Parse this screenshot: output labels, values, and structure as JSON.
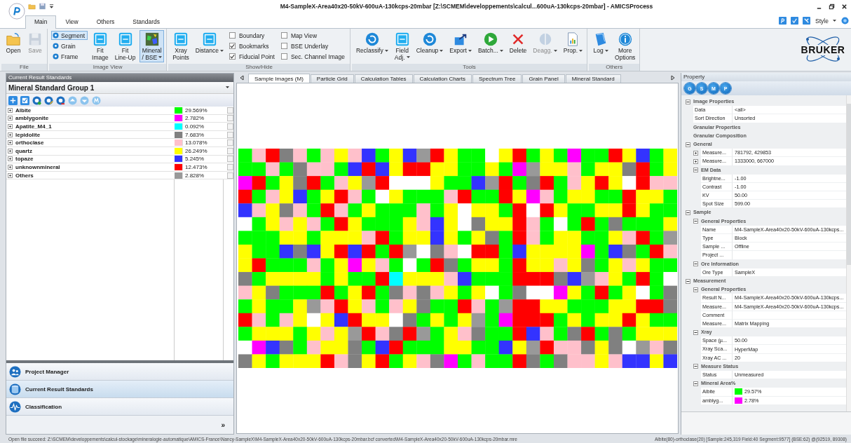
{
  "window": {
    "title": "M4-SampleX-Area40x20-50kV-600uA-130kcps-20mbar [Z:\\SCMEM\\developpements\\calcul...600uA-130kcps-20mbar] - AMICSProcess"
  },
  "ribbon_tabs": [
    {
      "label": "Main",
      "selected": true
    },
    {
      "label": "View",
      "selected": false
    },
    {
      "label": "Others",
      "selected": false
    },
    {
      "label": "Standards",
      "selected": false
    }
  ],
  "style_menu": {
    "label": "Style"
  },
  "ribbon_groups": [
    {
      "label": "File",
      "items": [
        {
          "kind": "large",
          "label": "Open",
          "disabled": false,
          "pressed": false,
          "dropdown": false
        },
        {
          "kind": "large",
          "label": "Save",
          "disabled": true,
          "pressed": false,
          "dropdown": false
        }
      ]
    },
    {
      "label": "Image View",
      "items": [
        {
          "kind": "radio",
          "label": "Segment",
          "selected": true
        },
        {
          "kind": "radio",
          "label": "Grain",
          "selected": false
        },
        {
          "kind": "radio",
          "label": "Frame",
          "selected": false
        },
        {
          "kind": "large",
          "label": "Fit\nImage",
          "disabled": false,
          "pressed": false,
          "dropdown": false
        },
        {
          "kind": "large",
          "label": "Fit\nLine-Up",
          "disabled": false,
          "pressed": false,
          "dropdown": false
        },
        {
          "kind": "large",
          "label": "Mineral\n/ BSE",
          "disabled": false,
          "pressed": true,
          "dropdown": true
        }
      ]
    },
    {
      "label": "Show/Hide",
      "items": [
        {
          "kind": "large",
          "label": "Xray\nPoints",
          "disabled": false,
          "pressed": false,
          "dropdown": false
        },
        {
          "kind": "large",
          "label": "Distance",
          "disabled": false,
          "pressed": false,
          "dropdown": true
        },
        {
          "kind": "check",
          "label": "Boundary",
          "checked": false
        },
        {
          "kind": "check",
          "label": "Bookmarks",
          "checked": true
        },
        {
          "kind": "check",
          "label": "Fiducial Point",
          "checked": true
        },
        {
          "kind": "check",
          "label": "Map View",
          "checked": false
        },
        {
          "kind": "check",
          "label": "BSE Underlay",
          "checked": false
        },
        {
          "kind": "check",
          "label": "Sec. Channel Image",
          "checked": false
        }
      ]
    },
    {
      "label": "Tools",
      "items": [
        {
          "kind": "large",
          "label": "Reclassify",
          "disabled": false,
          "pressed": false,
          "dropdown": true
        },
        {
          "kind": "large",
          "label": "Field\nAdj.",
          "disabled": false,
          "pressed": false,
          "dropdown": true
        },
        {
          "kind": "large",
          "label": "Cleanup",
          "disabled": false,
          "pressed": false,
          "dropdown": true
        },
        {
          "kind": "large",
          "label": "Export",
          "disabled": false,
          "pressed": false,
          "dropdown": true
        },
        {
          "kind": "large",
          "label": "Batch...",
          "disabled": false,
          "pressed": false,
          "dropdown": true
        },
        {
          "kind": "large",
          "label": "Delete",
          "disabled": false,
          "pressed": false,
          "dropdown": false
        },
        {
          "kind": "large",
          "label": "Deagg.",
          "disabled": true,
          "pressed": false,
          "dropdown": true
        },
        {
          "kind": "large",
          "label": "Prop.",
          "disabled": false,
          "pressed": false,
          "dropdown": true
        }
      ]
    },
    {
      "label": "Others",
      "items": [
        {
          "kind": "large",
          "label": "Log",
          "disabled": false,
          "pressed": false,
          "dropdown": true
        },
        {
          "kind": "large",
          "label": "More\nOptions",
          "disabled": false,
          "pressed": false,
          "dropdown": false
        }
      ]
    }
  ],
  "brand": {
    "logo_text": "BRUKER"
  },
  "left_panel": {
    "header": "Current Result Standards",
    "group_select": {
      "value": "Mineral Standard Group 1"
    }
  },
  "minerals": [
    {
      "name": "Albite",
      "color": "#00ff00",
      "percent": "29.569%",
      "checked": false
    },
    {
      "name": "amblygonite",
      "color": "#ff00ff",
      "percent": "2.782%",
      "checked": false
    },
    {
      "name": "Apatite_M4_1",
      "color": "#00ffff",
      "percent": "0.092%",
      "checked": false
    },
    {
      "name": "lepidolite",
      "color": "#808080",
      "percent": "7.683%",
      "checked": false
    },
    {
      "name": "orthoclase",
      "color": "#ffc0cb",
      "percent": "13.078%",
      "checked": false
    },
    {
      "name": "quartz",
      "color": "#ffff00",
      "percent": "26.249%",
      "checked": false
    },
    {
      "name": "topaze",
      "color": "#3333ff",
      "percent": "5.245%",
      "checked": false
    },
    {
      "name": "unknownmineral",
      "color": "#ff0000",
      "percent": "12.473%",
      "checked": false
    },
    {
      "name": "Others",
      "color": "#999999",
      "percent": "2.828%",
      "checked": false
    }
  ],
  "nav": [
    {
      "label": "Project Manager",
      "selected": false
    },
    {
      "label": "Current Result Standards",
      "selected": true
    },
    {
      "label": "Classification",
      "selected": false
    }
  ],
  "nav_more": "»",
  "view_tabs": [
    {
      "label": "Sample Images (M)",
      "selected": true
    },
    {
      "label": "Particle Grid",
      "selected": false
    },
    {
      "label": "Calculation Tables",
      "selected": false
    },
    {
      "label": "Calculation Charts",
      "selected": false
    },
    {
      "label": "Spectrum Tree",
      "selected": false
    },
    {
      "label": "Grain Panel",
      "selected": false
    },
    {
      "label": "Mineral Standard",
      "selected": false
    }
  ],
  "property_panel": {
    "header": "Property",
    "view_buttons": [
      {
        "label": "G"
      },
      {
        "label": "S"
      },
      {
        "label": "M"
      },
      {
        "label": "P"
      }
    ]
  },
  "properties": [
    {
      "kind": "category",
      "label": "Image Properties",
      "expanded": true,
      "children": [
        {
          "kind": "property",
          "name": "Data",
          "value": "<all>"
        },
        {
          "kind": "property",
          "name": "Sort Direction",
          "value": "Unsorted"
        }
      ]
    },
    {
      "kind": "category",
      "label": "Granular Properties"
    },
    {
      "kind": "category",
      "label": "Granular Composition"
    },
    {
      "kind": "category",
      "label": "General",
      "expanded": true,
      "children": [
        {
          "kind": "property",
          "name": "Measure...",
          "value": "781792, 429853",
          "expanded": false
        },
        {
          "kind": "property",
          "name": "Measure...",
          "value": "1333000, 667000",
          "expanded": false
        },
        {
          "kind": "category",
          "label": "EM Data",
          "expanded": true,
          "children": [
            {
              "kind": "property",
              "name": "Brightne...",
              "value": "-1.00"
            },
            {
              "kind": "property",
              "name": "Contrast",
              "value": "-1.00"
            },
            {
              "kind": "property",
              "name": "KV",
              "value": "50.00"
            },
            {
              "kind": "property",
              "name": "Spot Size",
              "value": "599.00"
            }
          ]
        }
      ]
    },
    {
      "kind": "category",
      "label": "Sample",
      "expanded": true,
      "children": [
        {
          "kind": "category",
          "label": "General Properties",
          "expanded": true,
          "children": [
            {
              "kind": "property",
              "name": "Name",
              "value": "M4-SampleX-Area40x20-50kV-600uA-130kcps..."
            },
            {
              "kind": "property",
              "name": "Type",
              "value": "Block"
            },
            {
              "kind": "property",
              "name": "Sample ...",
              "value": "Offline"
            },
            {
              "kind": "property",
              "name": "Project ..."
            }
          ]
        },
        {
          "kind": "category",
          "label": "Ore Information",
          "expanded": true,
          "children": [
            {
              "kind": "property",
              "name": "Ore Type",
              "value": "SampleX"
            }
          ]
        }
      ]
    },
    {
      "kind": "category",
      "label": "Measurement",
      "expanded": true,
      "children": [
        {
          "kind": "category",
          "label": "General Properties",
          "expanded": true,
          "children": [
            {
              "kind": "property",
              "name": "Result N...",
              "value": "M4-SampleX-Area40x20-50kV-600uA-130kcps..."
            },
            {
              "kind": "property",
              "name": "Measure...",
              "value": "M4-SampleX-Area40x20-50kV-600uA-130kcps..."
            },
            {
              "kind": "property",
              "name": "Comment"
            },
            {
              "kind": "property",
              "name": "Measure...",
              "value": "Matrix Mapping"
            }
          ]
        },
        {
          "kind": "category",
          "label": "Xray",
          "expanded": true,
          "children": [
            {
              "kind": "property",
              "name": "Space (µ...",
              "value": "50.00"
            },
            {
              "kind": "property",
              "name": "Xray Sca...",
              "value": "HyperMap"
            },
            {
              "kind": "property",
              "name": "Xray AC ...",
              "value": "20"
            }
          ]
        },
        {
          "kind": "category",
          "label": "Measure Status",
          "expanded": true,
          "children": [
            {
              "kind": "property",
              "name": "Status",
              "value": "Unmeasured"
            }
          ]
        },
        {
          "kind": "category",
          "label": "Mineral Area%",
          "expanded": true,
          "children": [
            {
              "kind": "property",
              "name": "Albite",
              "value": "29.57%",
              "color": "#00ff00"
            },
            {
              "kind": "property",
              "name": "amblyg...",
              "value": "2.78%",
              "color": "#ff00ff"
            }
          ]
        }
      ]
    }
  ],
  "status_bar": {
    "message": "Open file succeed: Z:\\SCMEM\\developpements\\calcul-stockage\\mineralogie-automatique\\AMICS-France\\Nancy-SampleX\\M4-SampleX-Area40x20-50kV-600uA-130kcps-20mbar.bcf converted\\M4-SampleX-Area40x20-50kV-600uA-130kcps-20mbar.mre",
    "cursor_info": "Albite(80)-orthoclase(20) [Sample:245,319 Field:40 Segment:9577] (BSE:62) @(92519, 89308)"
  }
}
